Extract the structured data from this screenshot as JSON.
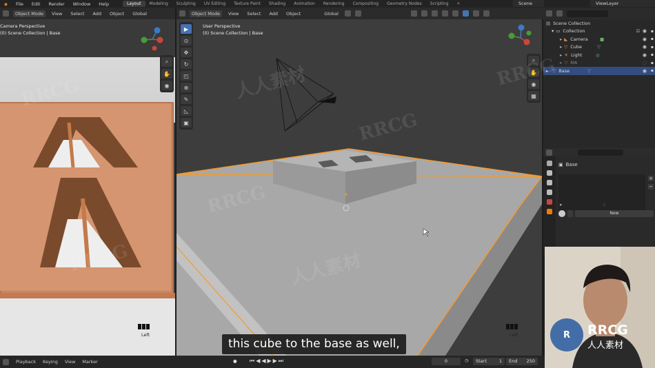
{
  "menubar": {
    "menus": [
      "File",
      "Edit",
      "Render",
      "Window",
      "Help"
    ],
    "workspaces": [
      "Layout",
      "Modeling",
      "Sculpting",
      "UV Editing",
      "Texture Paint",
      "Shading",
      "Animation",
      "Rendering",
      "Compositing",
      "Geometry Nodes",
      "Scripting",
      "+"
    ],
    "active_workspace": "Layout",
    "scene": "Scene",
    "view_layer": "ViewLayer"
  },
  "left_viewport": {
    "header": {
      "mode": "Object Mode",
      "menus": [
        "View",
        "Select",
        "Add",
        "Object"
      ],
      "orientation": "Global"
    },
    "title": "Camera Perspective",
    "collection": "(0) Scene Collection | Base",
    "view_label": "Left"
  },
  "main_viewport": {
    "header": {
      "mode": "Object Mode",
      "menus": [
        "View",
        "Select",
        "Add",
        "Object"
      ],
      "orientation": "Global"
    },
    "title": "User Perspective",
    "collection": "(0) Scene Collection | Base",
    "view_label": "Left"
  },
  "outliner": {
    "root": "Scene Collection",
    "items": [
      {
        "label": "Collection",
        "icon": "collection-icon"
      },
      {
        "label": "Camera",
        "icon": "camera-icon"
      },
      {
        "label": "Cube",
        "icon": "mesh-icon"
      },
      {
        "label": "Light",
        "icon": "light-icon"
      },
      {
        "label": "MA",
        "icon": "mesh-icon"
      },
      {
        "label": "Base",
        "icon": "mesh-icon"
      }
    ]
  },
  "properties": {
    "object_name": "Base",
    "new_button": "New"
  },
  "timeline": {
    "menus": [
      "Playback",
      "Keying",
      "View",
      "Marker"
    ],
    "current_frame": "0",
    "start_label": "Start",
    "start_value": "1",
    "end_label": "End",
    "end_value": "250"
  },
  "subtitle": "this cube to the base as well,",
  "colors": {
    "accent_blue": "#4772b3",
    "selection_orange": "#f39b2e",
    "mesh_gray": "#9c9c9c"
  },
  "watermark": {
    "rrcg": "RRCG",
    "cn": "人人素材"
  }
}
